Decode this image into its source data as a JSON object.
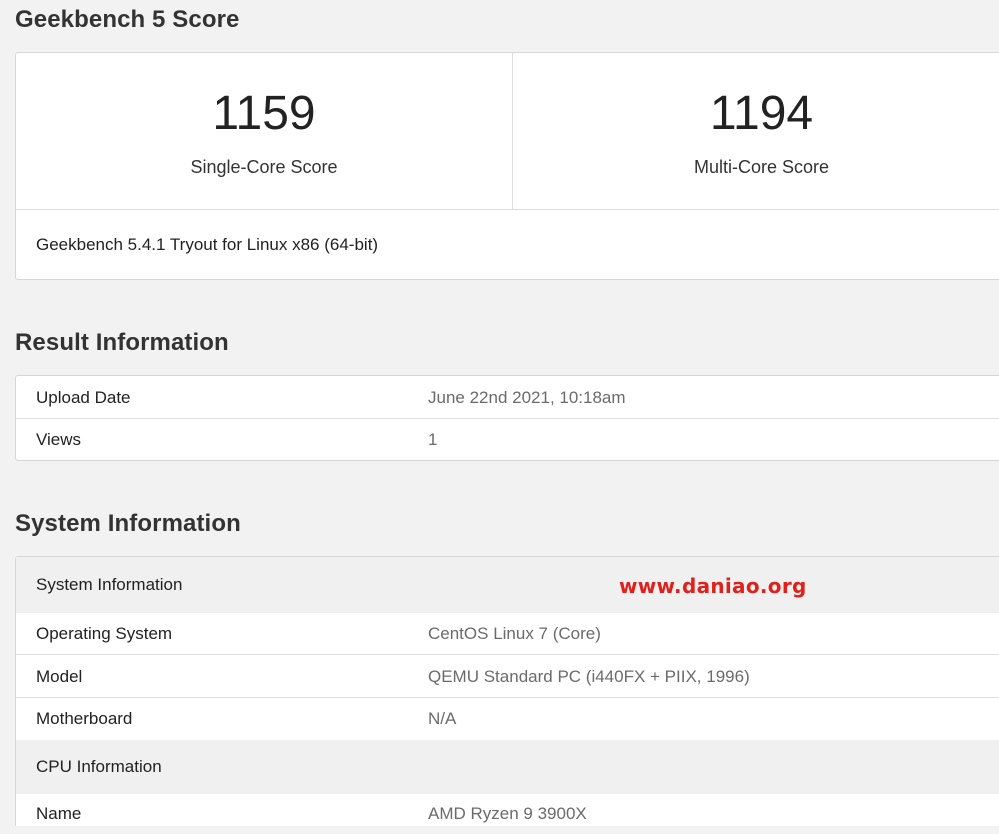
{
  "geekbench": {
    "title": "Geekbench 5 Score",
    "single_core": {
      "value": "1159",
      "label": "Single-Core Score"
    },
    "multi_core": {
      "value": "1194",
      "label": "Multi-Core Score"
    },
    "version": "Geekbench 5.4.1 Tryout for Linux x86 (64-bit)"
  },
  "result_info": {
    "title": "Result Information",
    "rows": [
      {
        "key": "Upload Date",
        "value": "June 22nd 2021, 10:18am"
      },
      {
        "key": "Views",
        "value": "1"
      }
    ]
  },
  "system_info": {
    "title": "System Information",
    "group_system": "System Information",
    "rows": [
      {
        "key": "Operating System",
        "value": "CentOS Linux 7 (Core)"
      },
      {
        "key": "Model",
        "value": "QEMU Standard PC (i440FX + PIIX, 1996)"
      },
      {
        "key": "Motherboard",
        "value": "N/A"
      }
    ],
    "group_cpu": "CPU Information",
    "cpu_rows": [
      {
        "key": "Name",
        "value": "AMD Ryzen 9 3900X"
      }
    ]
  },
  "watermark": "www.daniao.org",
  "colors": {
    "background": "#f2f2f2",
    "watermark": "#e0211b",
    "value_text": "#6b6b6b"
  }
}
